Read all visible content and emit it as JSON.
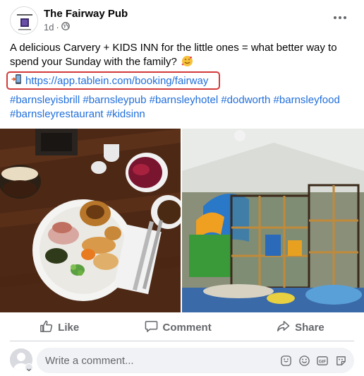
{
  "post": {
    "page_name": "The Fairway Pub",
    "time": "1d",
    "dot": "·",
    "text": "A delicious Carvery + KIDS INN for the little ones = what better way to spend your Sunday with the family?",
    "link": "https://app.tablein.com/booking/fairway",
    "hashtags": "#barnsleyisbrill #barnsleypub #barnsleyhotel #dodworth #barnsleyfood #barnsleyrestaurant #kidsinn"
  },
  "actions": {
    "like": "Like",
    "comment": "Comment",
    "share": "Share"
  },
  "comment_box": {
    "placeholder": "Write a comment...",
    "icons": [
      "sticker-icon",
      "emoji-icon",
      "gif-icon",
      "sticker-face-icon"
    ]
  },
  "colors": {
    "link": "#216fdb",
    "highlight_border": "#d33a3a",
    "secondary_text": "#65676b"
  }
}
